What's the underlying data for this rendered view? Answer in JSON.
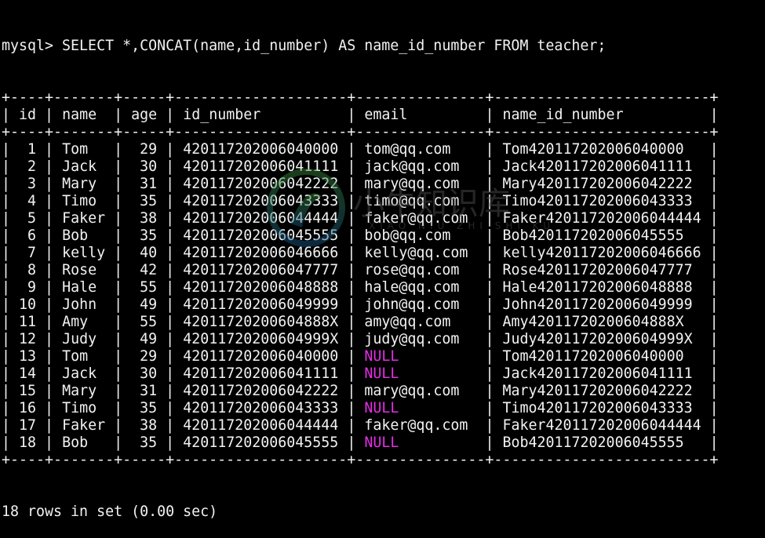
{
  "prompt": "mysql> SELECT *,CONCAT(name,id_number) AS name_id_number FROM teacher;",
  "columns": [
    {
      "name": "id",
      "width": 2,
      "align": "right"
    },
    {
      "name": "name",
      "width": 5,
      "align": "left"
    },
    {
      "name": "age",
      "width": 3,
      "align": "right"
    },
    {
      "name": "id_number",
      "width": 18,
      "align": "left"
    },
    {
      "name": "email",
      "width": 13,
      "align": "left"
    },
    {
      "name": "name_id_number",
      "width": 23,
      "align": "left"
    }
  ],
  "rows": [
    [
      "1",
      "Tom",
      "29",
      "420117202006040000",
      "tom@qq.com",
      "Tom420117202006040000"
    ],
    [
      "2",
      "Jack",
      "30",
      "420117202006041111",
      "jack@qq.com",
      "Jack420117202006041111"
    ],
    [
      "3",
      "Mary",
      "31",
      "420117202006042222",
      "mary@qq.com",
      "Mary420117202006042222"
    ],
    [
      "4",
      "Timo",
      "35",
      "420117202006043333",
      "timo@qq.com",
      "Timo420117202006043333"
    ],
    [
      "5",
      "Faker",
      "38",
      "420117202006044444",
      "faker@qq.com",
      "Faker420117202006044444"
    ],
    [
      "6",
      "Bob",
      "35",
      "420117202006045555",
      "bob@qq.com",
      "Bob420117202006045555"
    ],
    [
      "7",
      "kelly",
      "40",
      "420117202006046666",
      "kelly@qq.com",
      "kelly420117202006046666"
    ],
    [
      "8",
      "Rose",
      "42",
      "420117202006047777",
      "rose@qq.com",
      "Rose420117202006047777"
    ],
    [
      "9",
      "Hale",
      "55",
      "420117202006048888",
      "hale@qq.com",
      "Hale420117202006048888"
    ],
    [
      "10",
      "John",
      "49",
      "420117202006049999",
      "john@qq.com",
      "John420117202006049999"
    ],
    [
      "11",
      "Amy",
      "55",
      "42011720200604888X",
      "amy@qq.com",
      "Amy42011720200604888X"
    ],
    [
      "12",
      "Judy",
      "49",
      "42011720200604999X",
      "judy@qq.com",
      "Judy42011720200604999X"
    ],
    [
      "13",
      "Tom",
      "29",
      "420117202006040000",
      "NULL",
      "Tom420117202006040000"
    ],
    [
      "14",
      "Jack",
      "30",
      "420117202006041111",
      "NULL",
      "Jack420117202006041111"
    ],
    [
      "15",
      "Mary",
      "31",
      "420117202006042222",
      "mary@qq.com",
      "Mary420117202006042222"
    ],
    [
      "16",
      "Timo",
      "35",
      "420117202006043333",
      "NULL",
      "Timo420117202006043333"
    ],
    [
      "17",
      "Faker",
      "38",
      "420117202006044444",
      "faker@qq.com",
      "Faker420117202006044444"
    ],
    [
      "18",
      "Bob",
      "35",
      "420117202006045555",
      "NULL",
      "Bob420117202006045555"
    ]
  ],
  "footer": "18 rows in set (0.00 sec)",
  "watermark": {
    "text": "小牛知识库",
    "subtext": "XIAO NIU ZHI SHI KU"
  },
  "colors": {
    "background": "#000000",
    "text": "#f2f2f2",
    "null": "#e52ee5"
  }
}
